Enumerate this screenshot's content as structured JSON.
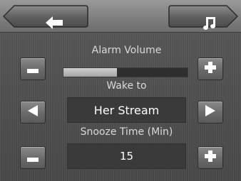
{
  "header": {
    "back_icon": "arrow-left-icon",
    "music_icon": "music-note-icon"
  },
  "alarm_volume": {
    "label": "Alarm Volume",
    "level_fraction": 0.43,
    "minus_icon": "minus-icon",
    "plus_icon": "plus-icon"
  },
  "wake_to": {
    "label": "Wake to",
    "value": "Her Stream",
    "prev_icon": "triangle-left-icon",
    "next_icon": "triangle-right-icon"
  },
  "snooze": {
    "label": "Snooze Time (Min)",
    "value": "15",
    "minus_icon": "minus-icon",
    "plus_icon": "plus-icon"
  },
  "colors": {
    "background": "#4a4a4a",
    "header": "#7d7d7d",
    "button": "#6a6a6a",
    "text": "#ffffff",
    "label": "#d9d9d9"
  }
}
